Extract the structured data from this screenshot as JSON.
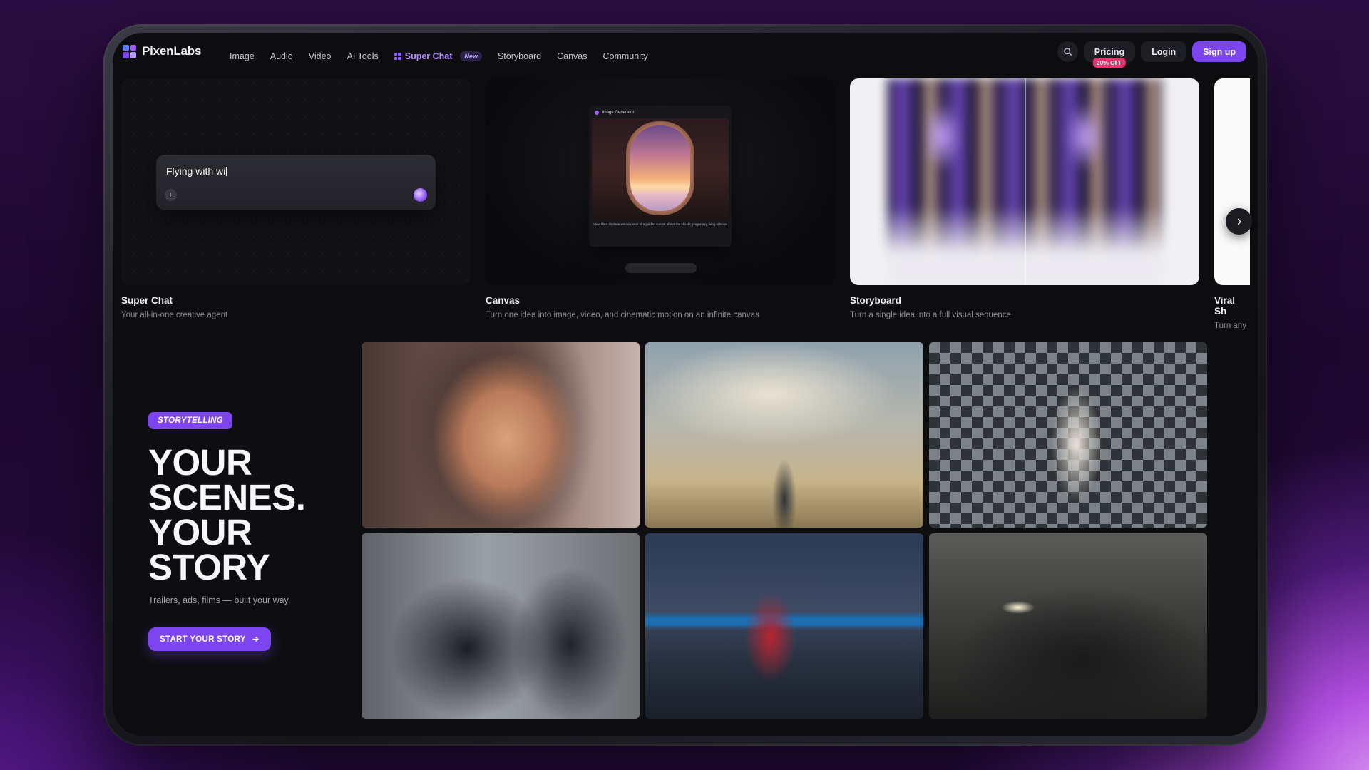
{
  "brand": {
    "name": "PixenLabs",
    "logo_icon": "grid-logo-icon",
    "colors": [
      "#5d7bff",
      "#a35cff",
      "#7d45f0",
      "#b89cff"
    ]
  },
  "nav": {
    "links": [
      {
        "label": "Image"
      },
      {
        "label": "Audio"
      },
      {
        "label": "Video"
      },
      {
        "label": "AI Tools"
      },
      {
        "label": "Super Chat",
        "badge": "New",
        "highlighted": true
      },
      {
        "label": "Storyboard"
      },
      {
        "label": "Canvas"
      },
      {
        "label": "Community"
      }
    ],
    "search_icon": "search-icon",
    "pricing_label": "Pricing",
    "pricing_badge": "20% OFF",
    "login_label": "Login",
    "signup_label": "Sign up"
  },
  "features": [
    {
      "title": "Super Chat",
      "description": "Your all-in-one creative agent",
      "prompt_text": "Flying with wi"
    },
    {
      "title": "Canvas",
      "description": "Turn one idea into image, video, and cinematic motion on an infinite canvas",
      "panel_title": "Image Generator",
      "caption": "View from airplane window seat of a golden sunset above the clouds, purple sky, wing silhouet"
    },
    {
      "title": "Storyboard",
      "description": "Turn a single idea into a full visual sequence"
    },
    {
      "title": "Viral Sh",
      "description": "Turn any"
    }
  ],
  "storytelling": {
    "tag": "STORYTELLING",
    "headline": [
      "YOUR",
      "SCENES.",
      "YOUR",
      "STORY"
    ],
    "subtitle": "Trailers, ads, films — built your way.",
    "cta_label": "START YOUR STORY"
  },
  "colors": {
    "accent": "#7d45f0",
    "badge_pink": "#e8356f",
    "screen_bg": "#0d0d10"
  }
}
